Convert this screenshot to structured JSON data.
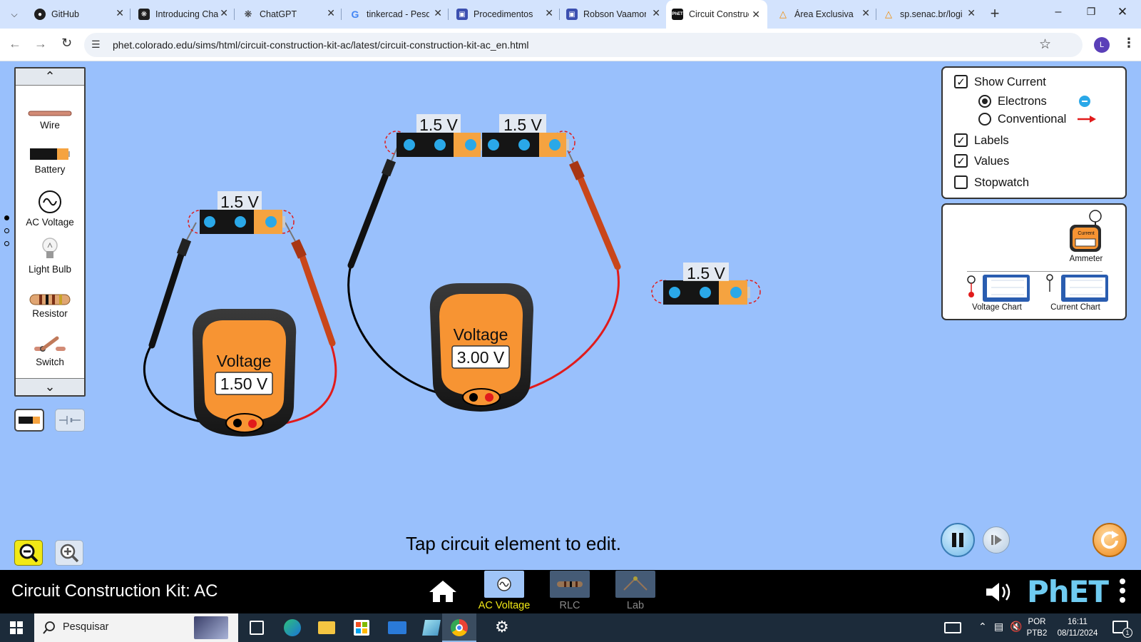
{
  "browser": {
    "tabs": [
      {
        "title": "GitHub",
        "icon": "github-icon"
      },
      {
        "title": "Introducing ChatGPT",
        "icon": "openai-icon"
      },
      {
        "title": "ChatGPT",
        "icon": "openai-icon"
      },
      {
        "title": "tinkercad - Pesquisa Google",
        "icon": "google-icon"
      },
      {
        "title": "Procedimentos",
        "icon": "forms-icon"
      },
      {
        "title": "Robson Vaamonde",
        "icon": "forms-icon"
      },
      {
        "title": "Circuit Construction Kit: AC",
        "icon": "phet-icon",
        "active": true
      },
      {
        "title": "Área Exclusiva",
        "icon": "senac-icon"
      },
      {
        "title": "sp.senac.br/login",
        "icon": "senac-icon"
      }
    ],
    "url": "phet.colorado.edu/sims/html/circuit-construction-kit-ac/latest/circuit-construction-kit-ac_en.html",
    "profile_initial": "L"
  },
  "toolbox": {
    "items": [
      {
        "label": "Wire",
        "icon": "wire-icon"
      },
      {
        "label": "Battery",
        "icon": "battery-icon"
      },
      {
        "label": "AC Voltage",
        "icon": "ac-voltage-icon"
      },
      {
        "label": "Light Bulb",
        "icon": "light-bulb-icon"
      },
      {
        "label": "Resistor",
        "icon": "resistor-icon"
      },
      {
        "label": "Switch",
        "icon": "switch-icon"
      }
    ]
  },
  "controls": {
    "show_current": {
      "label": "Show Current",
      "checked": true
    },
    "electrons": {
      "label": "Electrons",
      "selected": true
    },
    "conventional": {
      "label": "Conventional",
      "selected": false
    },
    "labels": {
      "label": "Labels",
      "checked": true
    },
    "values": {
      "label": "Values",
      "checked": true
    },
    "stopwatch": {
      "label": "Stopwatch",
      "checked": false
    }
  },
  "sensors": {
    "ammeter": "Ammeter",
    "ammeter_screen": "Current",
    "voltage_chart": "Voltage Chart",
    "current_chart": "Current Chart"
  },
  "circuit": {
    "batteries": [
      "1.5 V",
      "1.5 V",
      "1.5 V",
      "1.5 V"
    ],
    "voltmeters": [
      {
        "title": "Voltage",
        "reading": "1.50 V"
      },
      {
        "title": "Voltage",
        "reading": "3.00 V"
      }
    ]
  },
  "status_message": "Tap circuit element to edit.",
  "navbar": {
    "title": "Circuit Construction Kit: AC",
    "screens": [
      "AC Voltage",
      "RLC",
      "Lab"
    ],
    "active_screen": "AC Voltage",
    "brand": "PhET"
  },
  "taskbar": {
    "search_placeholder": "Pesquisar",
    "lang": "POR",
    "layout": "PTB2",
    "time": "16:11",
    "date": "08/11/2024",
    "notifications": "1"
  },
  "colors": {
    "sim_background": "#99c0fc",
    "battery_orange": "#f5a340",
    "meter_orange": "#f79433",
    "probe_red": "#e11b1b",
    "electron_blue": "#2aa8e8",
    "phet_blue": "#6fcbf1",
    "active_screen_label": "#f2e916"
  }
}
